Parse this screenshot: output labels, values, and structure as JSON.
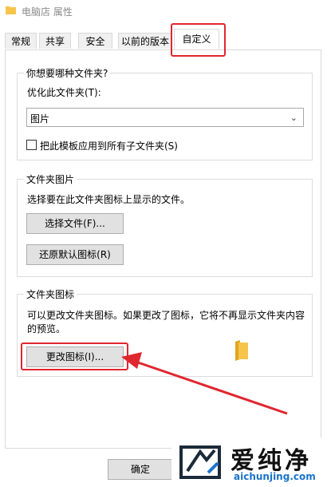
{
  "window": {
    "title": "电脑店 属性"
  },
  "tabs": [
    {
      "label": "常规"
    },
    {
      "label": "共享"
    },
    {
      "label": "安全"
    },
    {
      "label": "以前的版本"
    },
    {
      "label": "自定义",
      "active": true
    }
  ],
  "optimize_group": {
    "title": "你想要哪种文件夹?",
    "optimize_label": "优化此文件夹(T):",
    "select_value": "图片",
    "checkbox_label": "把此模板应用到所有子文件夹(S)",
    "checkbox_checked": false
  },
  "picture_group": {
    "title": "文件夹图片",
    "description": "选择要在此文件夹图标上显示的文件。",
    "choose_button": "选择文件(F)...",
    "restore_button": "还原默认图标(R)"
  },
  "icon_group": {
    "title": "文件夹图标",
    "description_line1": "可以更改文件夹图标。如果更改了图标，它将不再显示文件夹内容",
    "description_line2": "的预览。",
    "change_button": "更改图标(I)..."
  },
  "footer": {
    "ok_button": "确定"
  },
  "watermark": {
    "brand_cn": "爱纯净",
    "brand_en": "aichunjing.com"
  },
  "colors": {
    "highlight": "#e0262f",
    "folder": "#f6c44a",
    "brand_blue": "#1a73c9"
  }
}
